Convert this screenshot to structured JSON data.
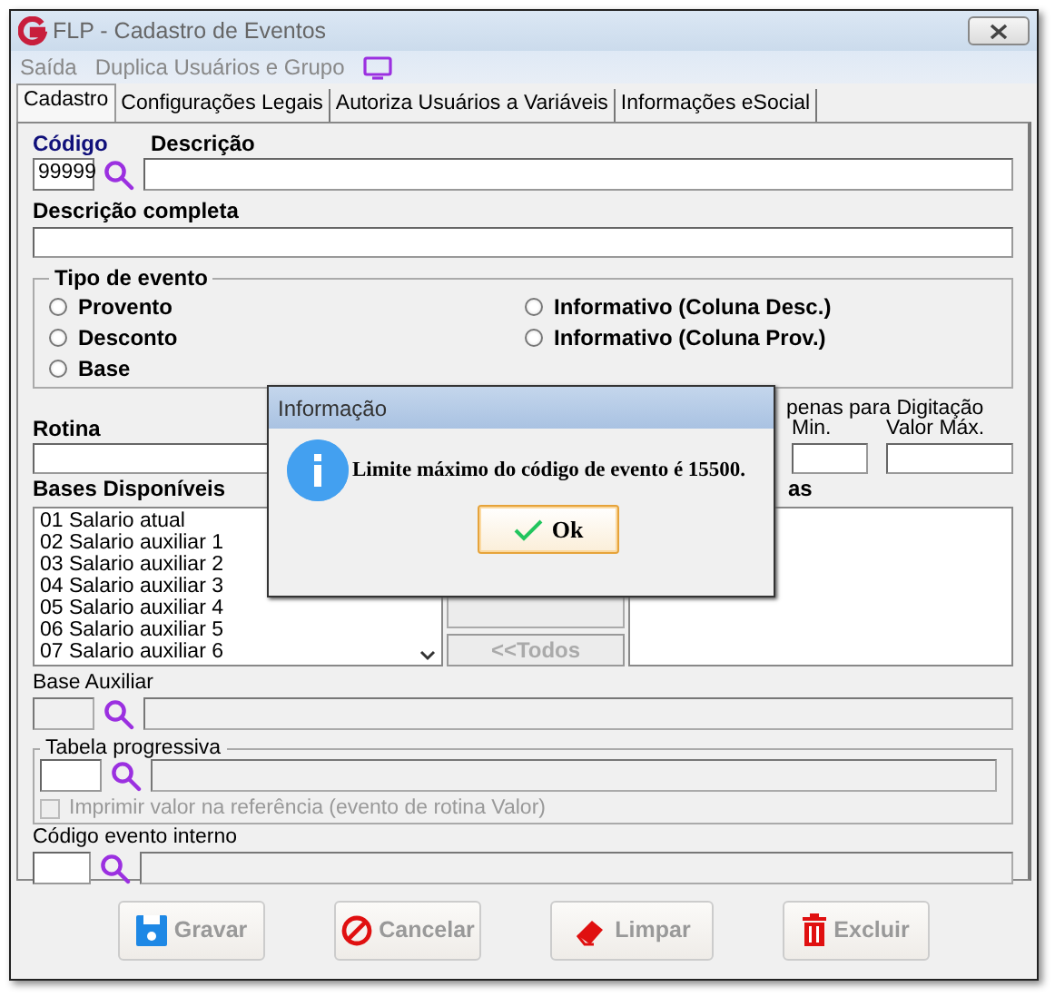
{
  "window": {
    "title": "FLP - Cadastro de Eventos"
  },
  "menu": [
    {
      "label": "Saída",
      "disabled": true
    },
    {
      "label": "Duplica Usuários e Grupo",
      "disabled": true
    }
  ],
  "tabs": [
    {
      "label": "Cadastro",
      "selected": true
    },
    {
      "label": "Configurações Legais",
      "selected": false
    },
    {
      "label": "Autoriza Usuários a Variáveis",
      "selected": false
    },
    {
      "label": "Informações eSocial",
      "selected": false
    }
  ],
  "codigo": {
    "label": "Código",
    "value": "99999"
  },
  "descricao": {
    "label": "Descrição"
  },
  "descricao_completa": {
    "label": "Descrição completa"
  },
  "tipo_evento": {
    "title": "Tipo de evento",
    "options": [
      {
        "label": "Provento",
        "selected": false
      },
      {
        "label": "Desconto",
        "selected": false
      },
      {
        "label": "Base",
        "selected": false
      },
      {
        "label": "Informativo (Coluna Desc.)",
        "selected": false
      },
      {
        "label": "Informativo (Coluna Prov.)",
        "selected": false
      }
    ]
  },
  "rotina": {
    "label": "Rotina"
  },
  "valores": {
    "caption": "penas para Digitação",
    "min_label": "Min.",
    "max_label": "Valor Máx."
  },
  "bases_disponiveis": {
    "label": "Bases Disponíveis",
    "items": [
      "01 Salario atual",
      "02 Salario auxiliar 1",
      "03 Salario auxiliar 2",
      "04 Salario auxiliar 3",
      "05 Salario auxiliar 4",
      "06 Salario auxiliar 5",
      "07 Salario auxiliar 6"
    ]
  },
  "bases_selecionadas": {
    "label": "as"
  },
  "move_buttons": [
    {
      "label": "<<Todos",
      "disabled": true
    }
  ],
  "base_auxiliar": {
    "label": "Base Auxiliar",
    "disabled": true
  },
  "tabela_progressiva": {
    "title": "Tabela progressiva",
    "checkbox": {
      "label": "Imprimir valor na referência (evento de rotina Valor)",
      "checked": false,
      "disabled": true
    }
  },
  "codigo_evento_interno": {
    "label": "Código evento interno"
  },
  "buttons": [
    {
      "label": "Gravar",
      "kind": "save"
    },
    {
      "label": "Cancelar",
      "kind": "cancel"
    },
    {
      "label": "Limpar",
      "kind": "clear"
    },
    {
      "label": "Excluir",
      "kind": "delete"
    }
  ],
  "dialog": {
    "title": "Informação",
    "message": "Limite máximo do código de evento é 15500.",
    "button": "Ok"
  }
}
